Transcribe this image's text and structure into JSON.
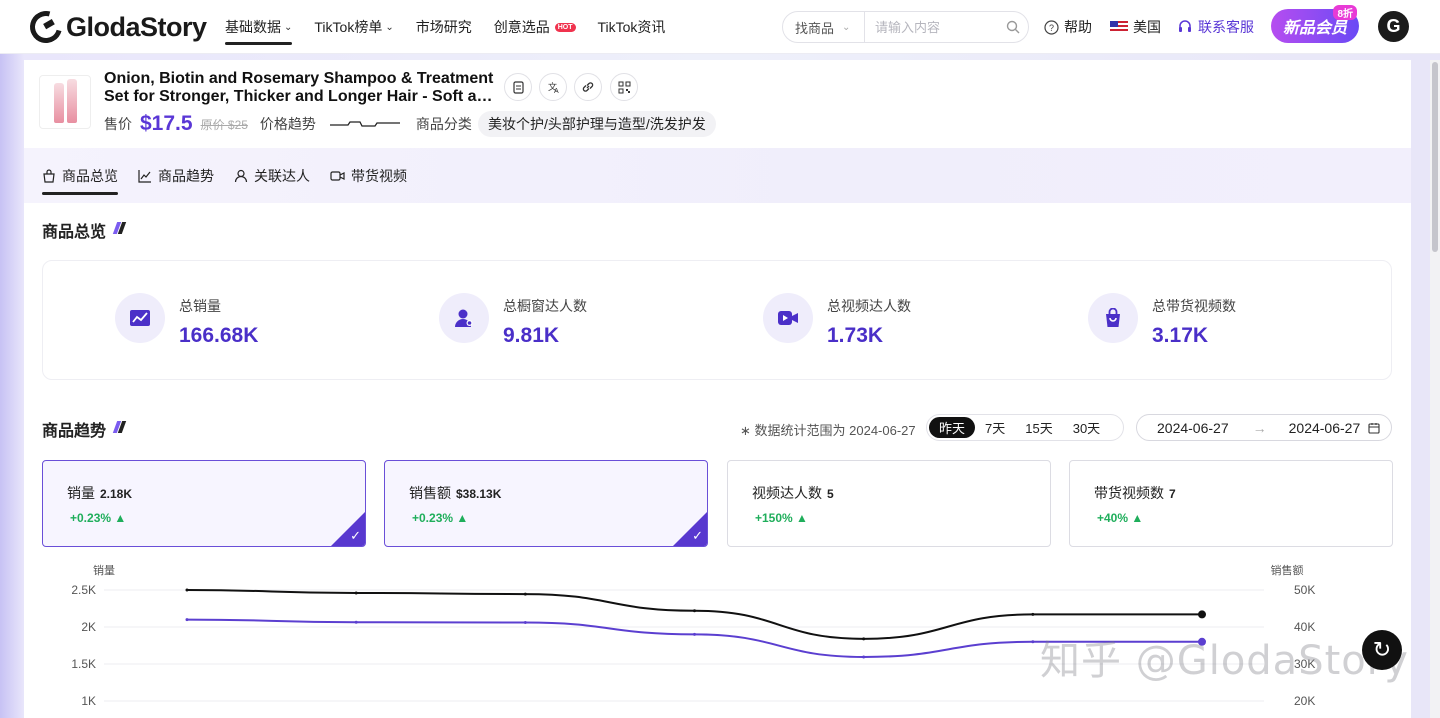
{
  "brand": {
    "name": "GlodaStory"
  },
  "nav": [
    {
      "label": "基础数据",
      "active": true,
      "dropdown": true
    },
    {
      "label": "TikTok榜单",
      "active": false,
      "dropdown": true
    },
    {
      "label": "市场研究",
      "active": false,
      "dropdown": false
    },
    {
      "label": "创意选品",
      "active": false,
      "dropdown": false,
      "badge": "HOT"
    },
    {
      "label": "TikTok资讯",
      "active": false,
      "dropdown": false
    }
  ],
  "search": {
    "type": "找商品",
    "placeholder": "请输入内容"
  },
  "util": {
    "help": "帮助",
    "region": "美国",
    "service": "联系客服"
  },
  "vip": {
    "label": "新品会员",
    "discount": "8折"
  },
  "user": {
    "initial": "G"
  },
  "product": {
    "title_line1": "Onion, Biotin and Rosemary Shampoo & Treatment",
    "title_line2": "Set for Stronger, Thicker and Longer Hair - Soft an...",
    "price_label": "售价",
    "price": "$17.5",
    "original_price": "原价 $25",
    "trend_label": "价格趋势",
    "category_label": "商品分类",
    "category": "美妆个护/头部护理与造型/洗发护发"
  },
  "tabs": [
    {
      "label": "商品总览",
      "icon": "bag-icon",
      "active": true
    },
    {
      "label": "商品趋势",
      "icon": "trend-icon",
      "active": false
    },
    {
      "label": "关联达人",
      "icon": "person-icon",
      "active": false
    },
    {
      "label": "带货视频",
      "icon": "video-icon",
      "active": false
    }
  ],
  "overview": {
    "title": "商品总览",
    "items": [
      {
        "label": "总销量",
        "value": "166.68K",
        "icon": "chart-icon"
      },
      {
        "label": "总橱窗达人数",
        "value": "9.81K",
        "icon": "user-icon"
      },
      {
        "label": "总视频达人数",
        "value": "1.73K",
        "icon": "video-icon"
      },
      {
        "label": "总带货视频数",
        "value": "3.17K",
        "icon": "bag-icon"
      }
    ]
  },
  "trend": {
    "title": "商品趋势",
    "range_note": "数据统计范围为 2024-06-27",
    "periods": [
      "昨天",
      "7天",
      "15天",
      "30天"
    ],
    "active_period": "昨天",
    "date_start": "2024-06-27",
    "date_end": "2024-06-27",
    "metrics": [
      {
        "label": "销量",
        "value": "2.18K",
        "delta": "+0.23%",
        "selected": true
      },
      {
        "label": "销售额",
        "value": "$38.13K",
        "delta": "+0.23%",
        "selected": true
      },
      {
        "label": "视频达人数",
        "value": "5",
        "delta": "+150%",
        "selected": false
      },
      {
        "label": "带货视频数",
        "value": "7",
        "delta": "+40%",
        "selected": false
      }
    ]
  },
  "chart_data": {
    "type": "line",
    "ylabel": "销量",
    "ylabel_right": "销售额",
    "left_ticks": [
      "2.5K",
      "2K",
      "1.5K",
      "1K"
    ],
    "right_ticks": [
      "50K",
      "40K",
      "30K",
      "20K"
    ],
    "ylim": [
      1000,
      2500
    ],
    "ylim_right": [
      20000,
      50000
    ],
    "series": [
      {
        "name": "销量",
        "axis": "left",
        "color": "#111111",
        "values": [
          2500,
          2460,
          2445,
          2220,
          1840,
          2170,
          2170
        ]
      },
      {
        "name": "销售额",
        "axis": "right",
        "color": "#5b3fd0",
        "values": [
          42000,
          41300,
          41200,
          38000,
          31900,
          36000,
          36000
        ]
      }
    ]
  },
  "watermark": {
    "text": "知乎 @GlodaStory"
  },
  "colors": {
    "accent": "#5a37d6",
    "positive": "#1fae5b",
    "brand_dark": "#111111"
  }
}
